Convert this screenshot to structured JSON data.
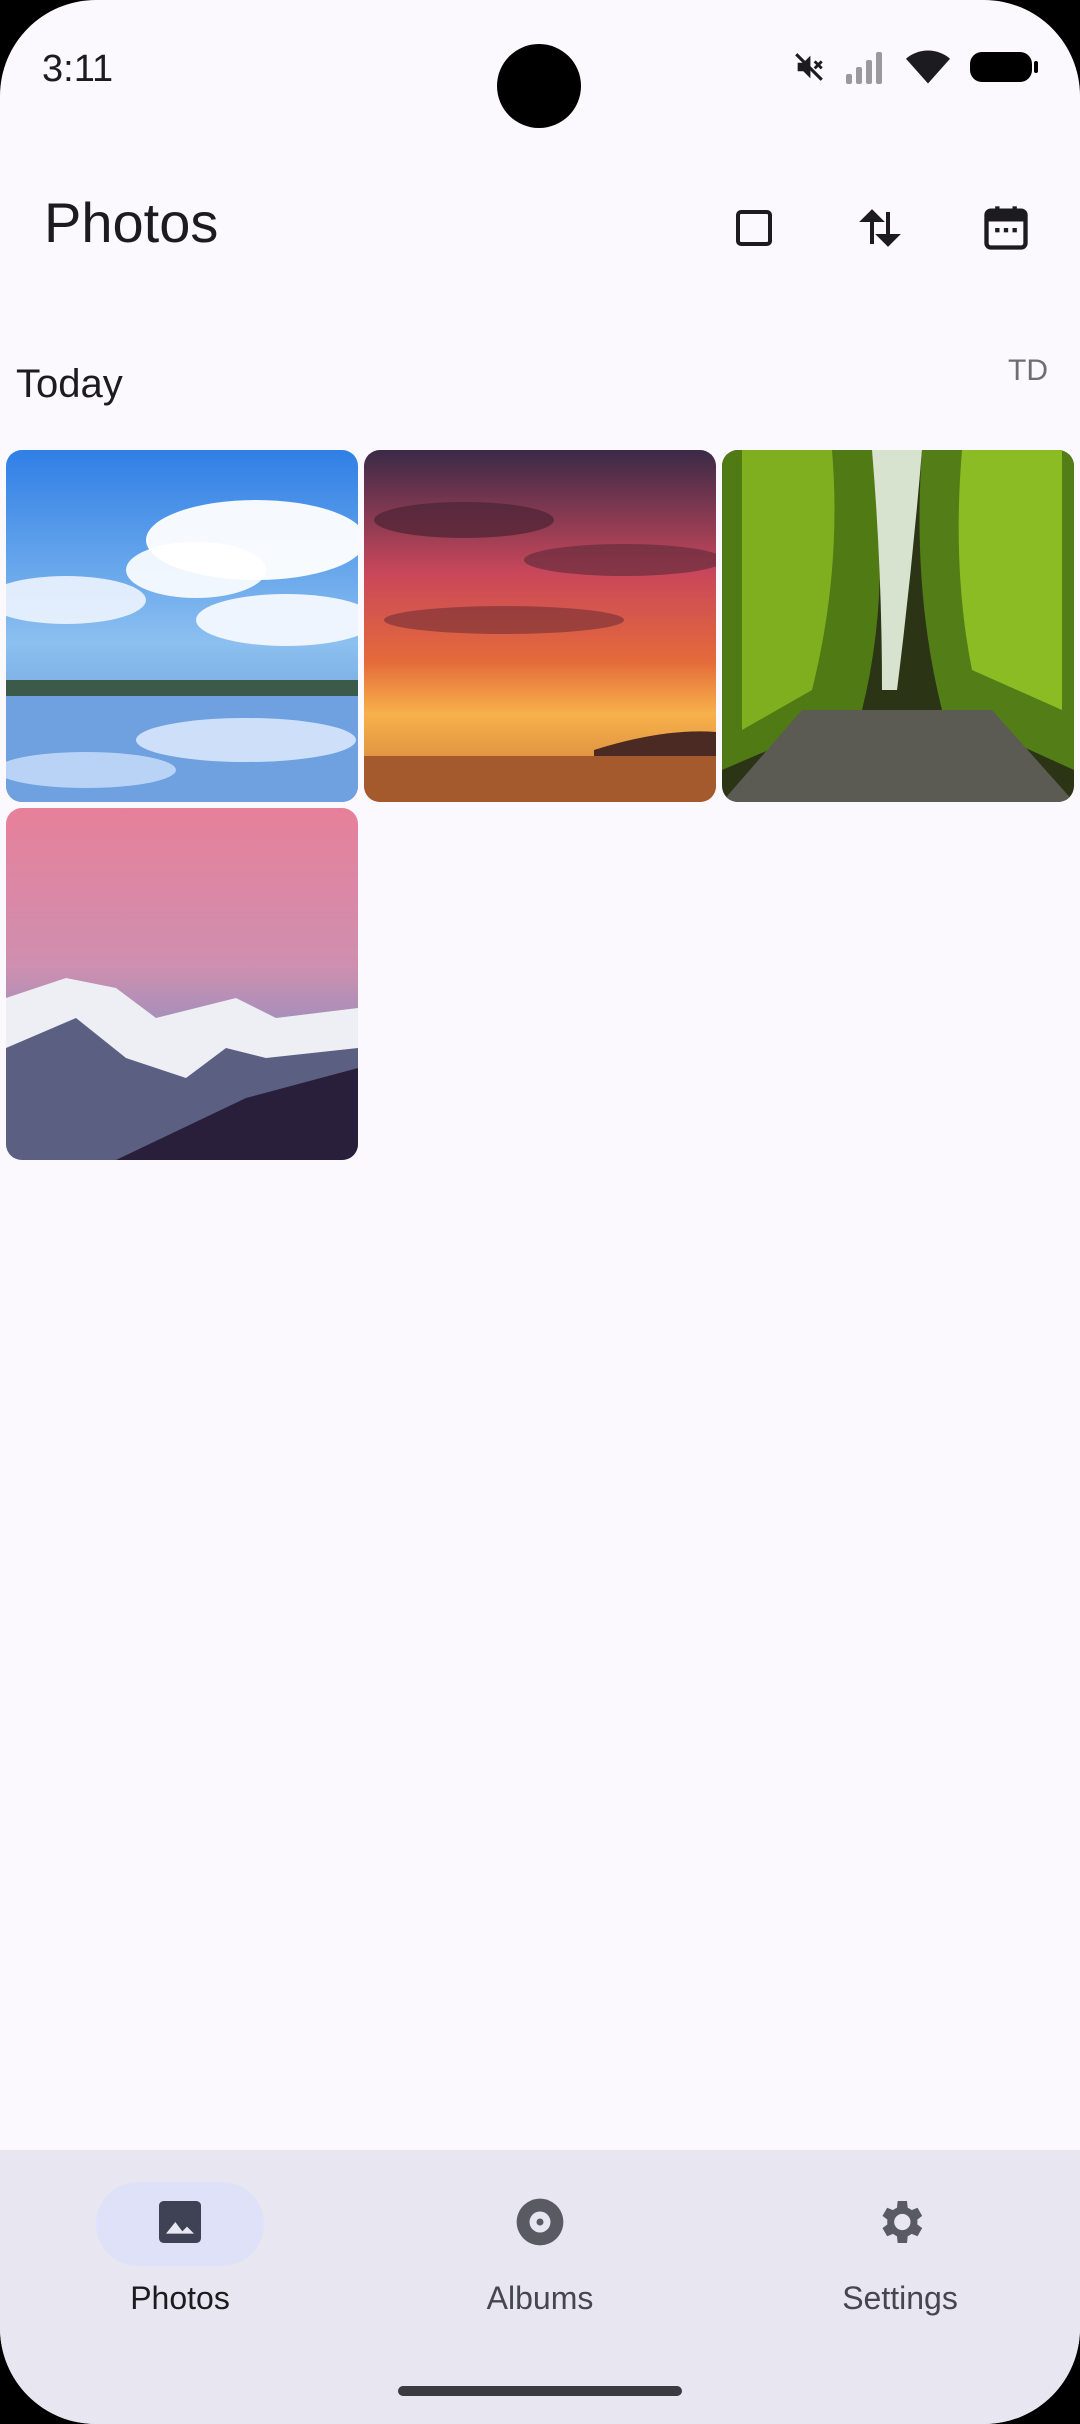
{
  "status_bar": {
    "time": "3:11",
    "icons": [
      "mute-icon",
      "signal-icon",
      "wifi-icon",
      "battery-icon"
    ]
  },
  "app_bar": {
    "title": "Photos",
    "actions": [
      "select-square-icon",
      "sort-arrows-icon",
      "calendar-icon"
    ]
  },
  "section": {
    "title": "Today",
    "side_label": "TD"
  },
  "photos": [
    {
      "name": "sky-reflection-lake",
      "colors": [
        "#3c89e8",
        "#ffffff",
        "#4a73b5"
      ]
    },
    {
      "name": "sunset-clouds-sea",
      "colors": [
        "#3b2a4a",
        "#d94a4a",
        "#f59a2a"
      ]
    },
    {
      "name": "mossy-canyon",
      "colors": [
        "#2c3a14",
        "#7fae1e",
        "#5a5a52"
      ]
    },
    {
      "name": "snowy-mountains-pink-sky",
      "colors": [
        "#d98fa6",
        "#eef0f5",
        "#2b2f52"
      ]
    }
  ],
  "bottom_nav": {
    "items": [
      {
        "label": "Photos",
        "icon": "image-icon",
        "active": true
      },
      {
        "label": "Albums",
        "icon": "album-icon",
        "active": false
      },
      {
        "label": "Settings",
        "icon": "gear-icon",
        "active": false
      }
    ]
  },
  "colors": {
    "background": "#fbf8fe",
    "nav_background": "#e8e6f0",
    "active_pill": "#dfe1f9",
    "text": "#1c1b1f"
  }
}
